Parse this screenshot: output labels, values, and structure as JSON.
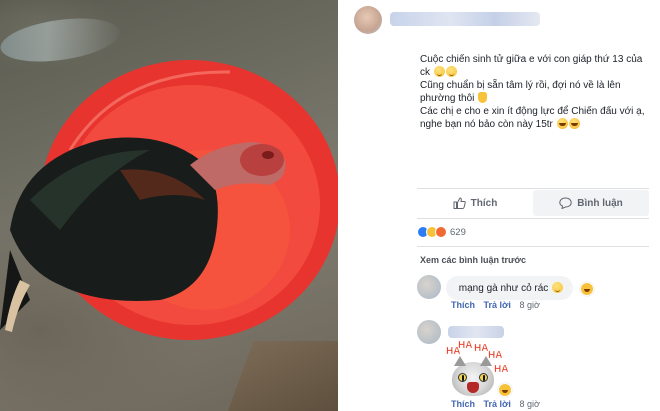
{
  "post": {
    "lines": [
      "Cuộc chiến sinh tử giữa e với con giáp thứ 13 của ck",
      "Cũng chuẩn bị sẵn tâm lý rồi, đợi nó về là lên phường thôi",
      "Các chị e cho e xin ít động lực để Chiến đấu với ạ, nghe bạn nó bảo còn này 15tr"
    ]
  },
  "actions": {
    "like_label": "Thích",
    "comment_label": "Bình luận"
  },
  "reactions": {
    "count": "629"
  },
  "comments": {
    "view_previous": "Xem các bình luận trước",
    "items": [
      {
        "text": "mạng gà như cỏ rác",
        "like_label": "Thích",
        "reply_label": "Trả lời",
        "time": "8 giờ"
      },
      {
        "sticker_text": "HA",
        "like_label": "Thích",
        "reply_label": "Trả lời",
        "time": "8 giờ"
      }
    ]
  },
  "colors": {
    "basin_red": "#e8342e",
    "link_blue": "#4267b2",
    "like_blue": "#2e7bf6"
  }
}
